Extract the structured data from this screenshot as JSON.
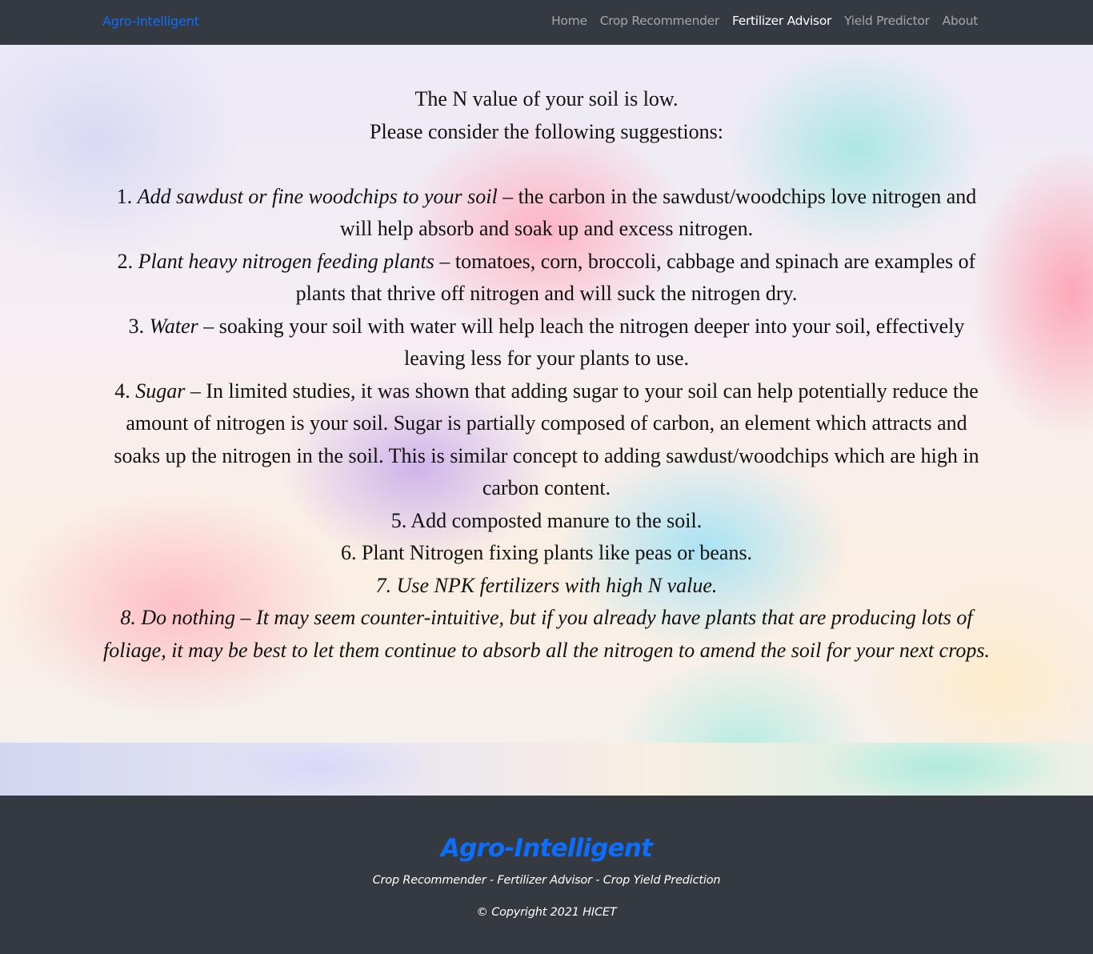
{
  "navbar": {
    "brand": "Agro-Intelligent",
    "links": [
      {
        "label": "Home",
        "active": false
      },
      {
        "label": "Crop Recommender",
        "active": false
      },
      {
        "label": "Fertilizer Advisor",
        "active": true
      },
      {
        "label": "Yield Predictor",
        "active": false
      },
      {
        "label": "About",
        "active": false
      }
    ]
  },
  "result": {
    "heading_line1": "The N value of your soil is low.",
    "heading_line2": "Please consider the following suggestions:",
    "suggestions": [
      {
        "num": "1.",
        "title": "Add sawdust or fine woodchips to your soil",
        "body": " – the carbon in the sawdust/woodchips love nitrogen and will help absorb and soak up and excess nitrogen."
      },
      {
        "num": "2.",
        "title": "Plant heavy nitrogen feeding plants",
        "body": " – tomatoes, corn, broccoli, cabbage and spinach are examples of plants that thrive off nitrogen and will suck the nitrogen dry."
      },
      {
        "num": "3.",
        "title": "Water",
        "body": " – soaking your soil with water will help leach the nitrogen deeper into your soil, effectively leaving less for your plants to use."
      },
      {
        "num": "4.",
        "title": "Sugar",
        "body": " – In limited studies, it was shown that adding sugar to your soil can help potentially reduce the amount of nitrogen is your soil. Sugar is partially composed of carbon, an element which attracts and soaks up the nitrogen in the soil. This is similar concept to adding sawdust/woodchips which are high in carbon content."
      },
      {
        "text": "5. Add composted manure to the soil."
      },
      {
        "text": "6. Plant Nitrogen fixing plants like peas or beans."
      },
      {
        "text": "7. Use NPK fertilizers with high N value."
      },
      {
        "text": "8. Do nothing – It may seem counter-intuitive, but if you already have plants that are producing lots of foliage, it may be best to let them continue to absorb all the nitrogen to amend the soil for your next crops."
      }
    ]
  },
  "footer": {
    "title": "Agro-Intelligent",
    "subtitle": "Crop Recommender - Fertilizer Advisor - Crop Yield Prediction",
    "copyright": "© Copyright 2021 HICET"
  }
}
